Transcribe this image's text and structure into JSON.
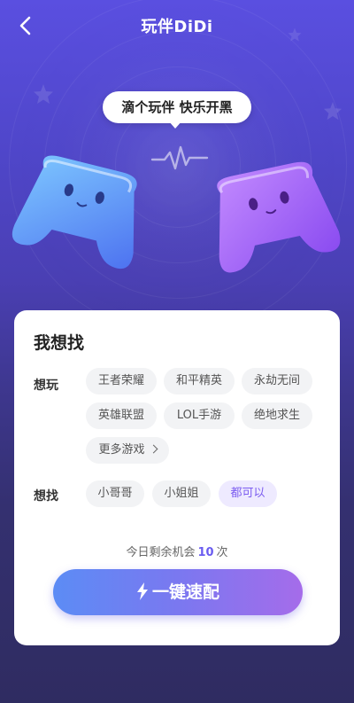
{
  "header": {
    "title": "玩伴DiDi"
  },
  "banner": {
    "bubble_text": "滴个玩伴 快乐开黑"
  },
  "form": {
    "section_title": "我想找",
    "games_label": "想玩",
    "games": [
      "王者荣耀",
      "和平精英",
      "永劫无间",
      "英雄联盟",
      "LOL手游",
      "绝地求生"
    ],
    "more_games_label": "更多游戏",
    "partner_label": "想找",
    "partners": [
      "小哥哥",
      "小姐姐",
      "都可以"
    ],
    "selected_partner": "都可以",
    "remaining_prefix": "今日剩余机会",
    "remaining_count": "10",
    "remaining_suffix": "次",
    "match_button_label": "一键速配"
  },
  "colors": {
    "accent": "#7b5cf0",
    "button_gradient_start": "#5c8cf5",
    "button_gradient_end": "#a56cea",
    "background_top": "#5a4fe0",
    "background_bottom": "#2f2c61"
  }
}
